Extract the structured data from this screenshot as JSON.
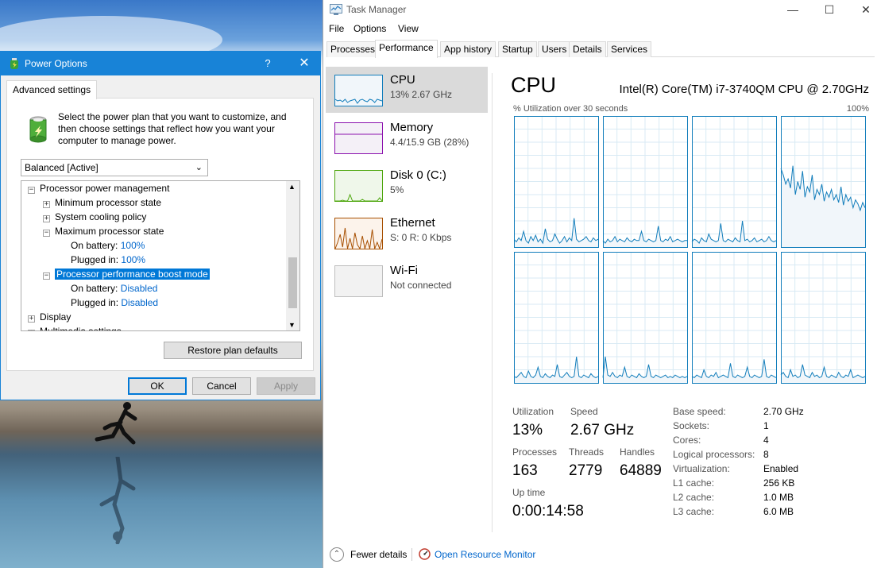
{
  "power_options": {
    "title": "Power Options",
    "help_glyph": "?",
    "close_glyph": "✕",
    "tab": "Advanced settings",
    "description": "Select the power plan that you want to customize, and then choose settings that reflect how you want your computer to manage power.",
    "plan_selected": "Balanced [Active]",
    "tree": [
      {
        "text": "Processor power management",
        "expander": "−",
        "value": "",
        "selected": false
      },
      {
        "text": "Minimum processor state",
        "expander": "+",
        "value": "",
        "selected": false
      },
      {
        "text": "System cooling policy",
        "expander": "+",
        "value": "",
        "selected": false
      },
      {
        "text": "Maximum processor state",
        "expander": "−",
        "value": "",
        "selected": false
      },
      {
        "text": "On battery:",
        "expander": "",
        "value": "100%",
        "selected": false
      },
      {
        "text": "Plugged in:",
        "expander": "",
        "value": "100%",
        "selected": false
      },
      {
        "text": "Processor performance boost mode",
        "expander": "−",
        "value": "",
        "selected": true
      },
      {
        "text": "On battery:",
        "expander": "",
        "value": "Disabled",
        "selected": false
      },
      {
        "text": "Plugged in:",
        "expander": "",
        "value": "Disabled",
        "selected": false
      },
      {
        "text": "Display",
        "expander": "+",
        "value": "",
        "selected": false
      },
      {
        "text": "Multimedia settings",
        "expander": "+",
        "value": "",
        "selected": false
      }
    ],
    "restore_label": "Restore plan defaults",
    "ok_label": "OK",
    "cancel_label": "Cancel",
    "apply_label": "Apply"
  },
  "task_manager": {
    "title": "Task Manager",
    "window_controls": [
      "—",
      "☐",
      "✕"
    ],
    "menu": [
      "File",
      "Options",
      "View"
    ],
    "tabs": [
      "Processes",
      "Performance",
      "App history",
      "Startup",
      "Users",
      "Details",
      "Services"
    ],
    "active_tab": "Performance",
    "sidebar": [
      {
        "name": "CPU",
        "sub": "13%  2.67 GHz",
        "color": "#117dbb",
        "fill": "#f1f6fa"
      },
      {
        "name": "Memory",
        "sub": "4.4/15.9 GB (28%)",
        "color": "#8b12ae",
        "fill": "#f4f0f7"
      },
      {
        "name": "Disk 0 (C:)",
        "sub": "5%",
        "color": "#4da60c",
        "fill": "#eff7ea"
      },
      {
        "name": "Ethernet",
        "sub": "S: 0  R: 0 Kbps",
        "color": "#a74f01",
        "fill": "#fcf3eb"
      },
      {
        "name": "Wi-Fi",
        "sub": "Not connected",
        "color": "#bdbdbd",
        "fill": "#f2f2f2"
      }
    ],
    "cpu": {
      "heading": "CPU",
      "model": "Intel(R) Core(TM) i7-3740QM CPU @ 2.70GHz",
      "util_label": "% Utilization over 30 seconds",
      "util_max": "100%",
      "graph_line_color": "#117dbb",
      "graph_grid_color": "#d9eaf4",
      "graph_fill_color": "#f1f6fa",
      "core_history": [
        [
          6,
          4,
          7,
          5,
          12,
          5,
          3,
          8,
          5,
          9,
          4,
          6,
          3,
          14,
          6,
          4,
          5,
          10,
          6,
          3,
          5,
          8,
          4,
          7,
          5,
          22,
          6,
          4,
          5,
          6,
          8,
          5,
          4,
          7,
          5,
          6
        ],
        [
          5,
          3,
          6,
          4,
          5,
          8,
          4,
          6,
          5,
          4,
          7,
          5,
          4,
          6,
          5,
          5,
          12,
          5,
          4,
          6,
          5,
          4,
          5,
          16,
          5,
          4,
          6,
          5,
          8,
          4,
          5,
          6,
          5,
          4,
          5,
          5
        ],
        [
          4,
          6,
          5,
          3,
          7,
          5,
          4,
          10,
          6,
          5,
          4,
          5,
          18,
          5,
          4,
          6,
          5,
          4,
          7,
          5,
          4,
          20,
          5,
          6,
          4,
          5,
          7,
          4,
          5,
          6,
          4,
          5,
          8,
          5,
          4,
          5
        ],
        [
          60,
          55,
          48,
          52,
          45,
          62,
          40,
          50,
          44,
          58,
          38,
          46,
          42,
          55,
          36,
          44,
          40,
          48,
          35,
          42,
          38,
          44,
          36,
          40,
          34,
          46,
          32,
          40,
          35,
          38,
          30,
          36,
          33,
          28,
          34,
          30
        ],
        [
          5,
          4,
          6,
          8,
          5,
          4,
          9,
          5,
          4,
          6,
          12,
          5,
          4,
          7,
          5,
          4,
          6,
          5,
          14,
          5,
          4,
          6,
          8,
          5,
          4,
          5,
          20,
          5,
          4,
          6,
          5,
          4,
          7,
          5,
          4,
          5
        ],
        [
          4,
          20,
          6,
          5,
          8,
          5,
          4,
          6,
          5,
          12,
          5,
          4,
          6,
          5,
          4,
          7,
          5,
          4,
          5,
          14,
          5,
          4,
          6,
          5,
          4,
          5,
          6,
          4,
          5,
          4,
          6,
          5,
          4,
          5,
          4,
          5
        ],
        [
          5,
          4,
          6,
          5,
          4,
          10,
          5,
          4,
          6,
          5,
          8,
          4,
          5,
          6,
          5,
          4,
          15,
          5,
          4,
          6,
          5,
          4,
          5,
          12,
          5,
          4,
          6,
          5,
          4,
          5,
          18,
          5,
          4,
          6,
          5,
          4
        ],
        [
          6,
          8,
          5,
          4,
          10,
          5,
          6,
          4,
          5,
          14,
          6,
          5,
          4,
          8,
          5,
          6,
          4,
          5,
          12,
          5,
          4,
          6,
          5,
          4,
          8,
          5,
          4,
          6,
          5,
          10,
          4,
          5,
          6,
          5,
          4,
          5
        ]
      ],
      "stats": {
        "utilization_label": "Utilization",
        "utilization": "13%",
        "speed_label": "Speed",
        "speed": "2.67 GHz",
        "processes_label": "Processes",
        "processes": "163",
        "threads_label": "Threads",
        "threads": "2779",
        "handles_label": "Handles",
        "handles": "64889",
        "uptime_label": "Up time",
        "uptime": "0:00:14:58"
      },
      "specs": [
        {
          "label": "Base speed:",
          "value": "2.70 GHz"
        },
        {
          "label": "Sockets:",
          "value": "1"
        },
        {
          "label": "Cores:",
          "value": "4"
        },
        {
          "label": "Logical processors:",
          "value": "8"
        },
        {
          "label": "Virtualization:",
          "value": "Enabled"
        },
        {
          "label": "L1 cache:",
          "value": "256 KB"
        },
        {
          "label": "L2 cache:",
          "value": "1.0 MB"
        },
        {
          "label": "L3 cache:",
          "value": "6.0 MB"
        }
      ]
    },
    "footer": {
      "fewer_details": "Fewer details",
      "resource_monitor": "Open Resource Monitor"
    }
  }
}
